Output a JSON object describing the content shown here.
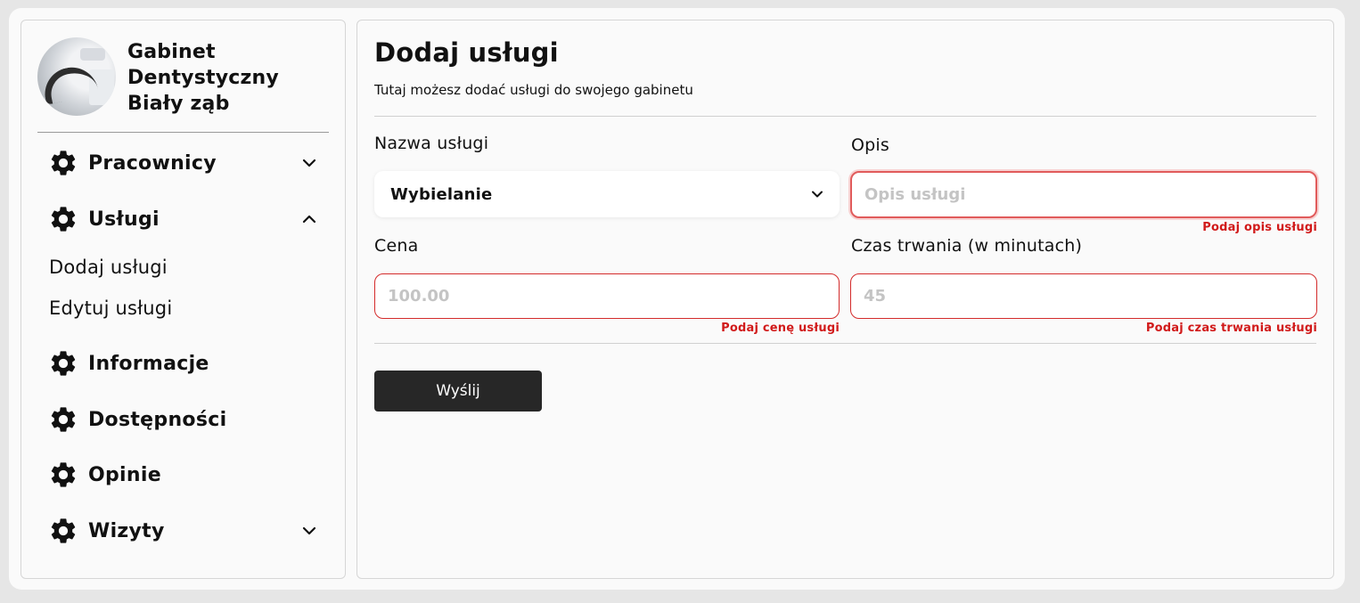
{
  "sidebar": {
    "brand_name": "Gabinet Dentystyczny Biały ząb",
    "items": [
      {
        "label": "Pracownicy",
        "expanded": false
      },
      {
        "label": "Usługi",
        "expanded": true,
        "subitems": [
          "Dodaj usługi",
          "Edytuj usługi"
        ]
      },
      {
        "label": "Informacje"
      },
      {
        "label": "Dostępności"
      },
      {
        "label": "Opinie"
      },
      {
        "label": "Wizyty",
        "expanded": false
      }
    ]
  },
  "form": {
    "title": "Dodaj usługi",
    "subtitle": "Tutaj możesz dodać usługi do swojego gabinetu",
    "name_label": "Nazwa usługi",
    "name_value": "Wybielanie",
    "description_label": "Opis",
    "description_placeholder": "Opis usługi",
    "description_error": "Podaj opis usługi",
    "price_label": "Cena",
    "price_placeholder": "100.00",
    "price_error": "Podaj cenę usługi",
    "duration_label": "Czas trwania (w minutach)",
    "duration_placeholder": "45",
    "duration_error": "Podaj czas trwania usługi",
    "submit_label": "Wyślij"
  },
  "colors": {
    "error": "#d11a1a",
    "button": "#272727",
    "background": "#fafafa"
  }
}
